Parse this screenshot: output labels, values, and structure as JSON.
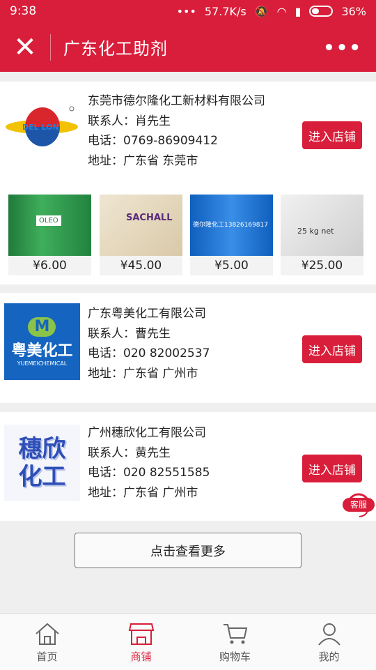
{
  "status": {
    "time": "9:38",
    "net_speed": "57.7K/s",
    "battery": "36%"
  },
  "header": {
    "title": "广东化工助剂"
  },
  "shops": [
    {
      "name": "东莞市德尔隆化工新材料有限公司",
      "contact": "联系人：肖先生",
      "phone": "电话：0769-86909412",
      "address": "地址：广东省 东莞市",
      "enter_label": "进入店铺",
      "logo_text": "DEL LON"
    },
    {
      "name": "广东粤美化工有限公司",
      "contact": "联系人：曹先生",
      "phone": "电话：020 82002537",
      "address": "地址：广东省 广州市",
      "enter_label": "进入店铺",
      "logo_text": "粤美化工",
      "logo_sub": "YUEMEICHEMICAL"
    },
    {
      "name": "广州穗欣化工有限公司",
      "contact": "联系人：黄先生",
      "phone": "电话：020 82551585",
      "address": "地址：广东省 广州市",
      "enter_label": "进入店铺",
      "logo_text": "穗欣化工"
    }
  ],
  "products": [
    {
      "price": "¥6.00",
      "label": "OLEO"
    },
    {
      "price": "¥45.00",
      "label": "SACHALL"
    },
    {
      "price": "¥5.00",
      "label": "德尔隆化工13826169817"
    },
    {
      "price": "¥25.00",
      "label": "25 kg net"
    }
  ],
  "load_more": "点击查看更多",
  "kefu": "客服",
  "tabs": [
    {
      "label": "首页",
      "icon": "home-icon"
    },
    {
      "label": "商铺",
      "icon": "shop-icon"
    },
    {
      "label": "购物车",
      "icon": "cart-icon"
    },
    {
      "label": "我的",
      "icon": "user-icon"
    }
  ],
  "colors": {
    "brand": "#d81e3a",
    "background": "#efefef"
  }
}
